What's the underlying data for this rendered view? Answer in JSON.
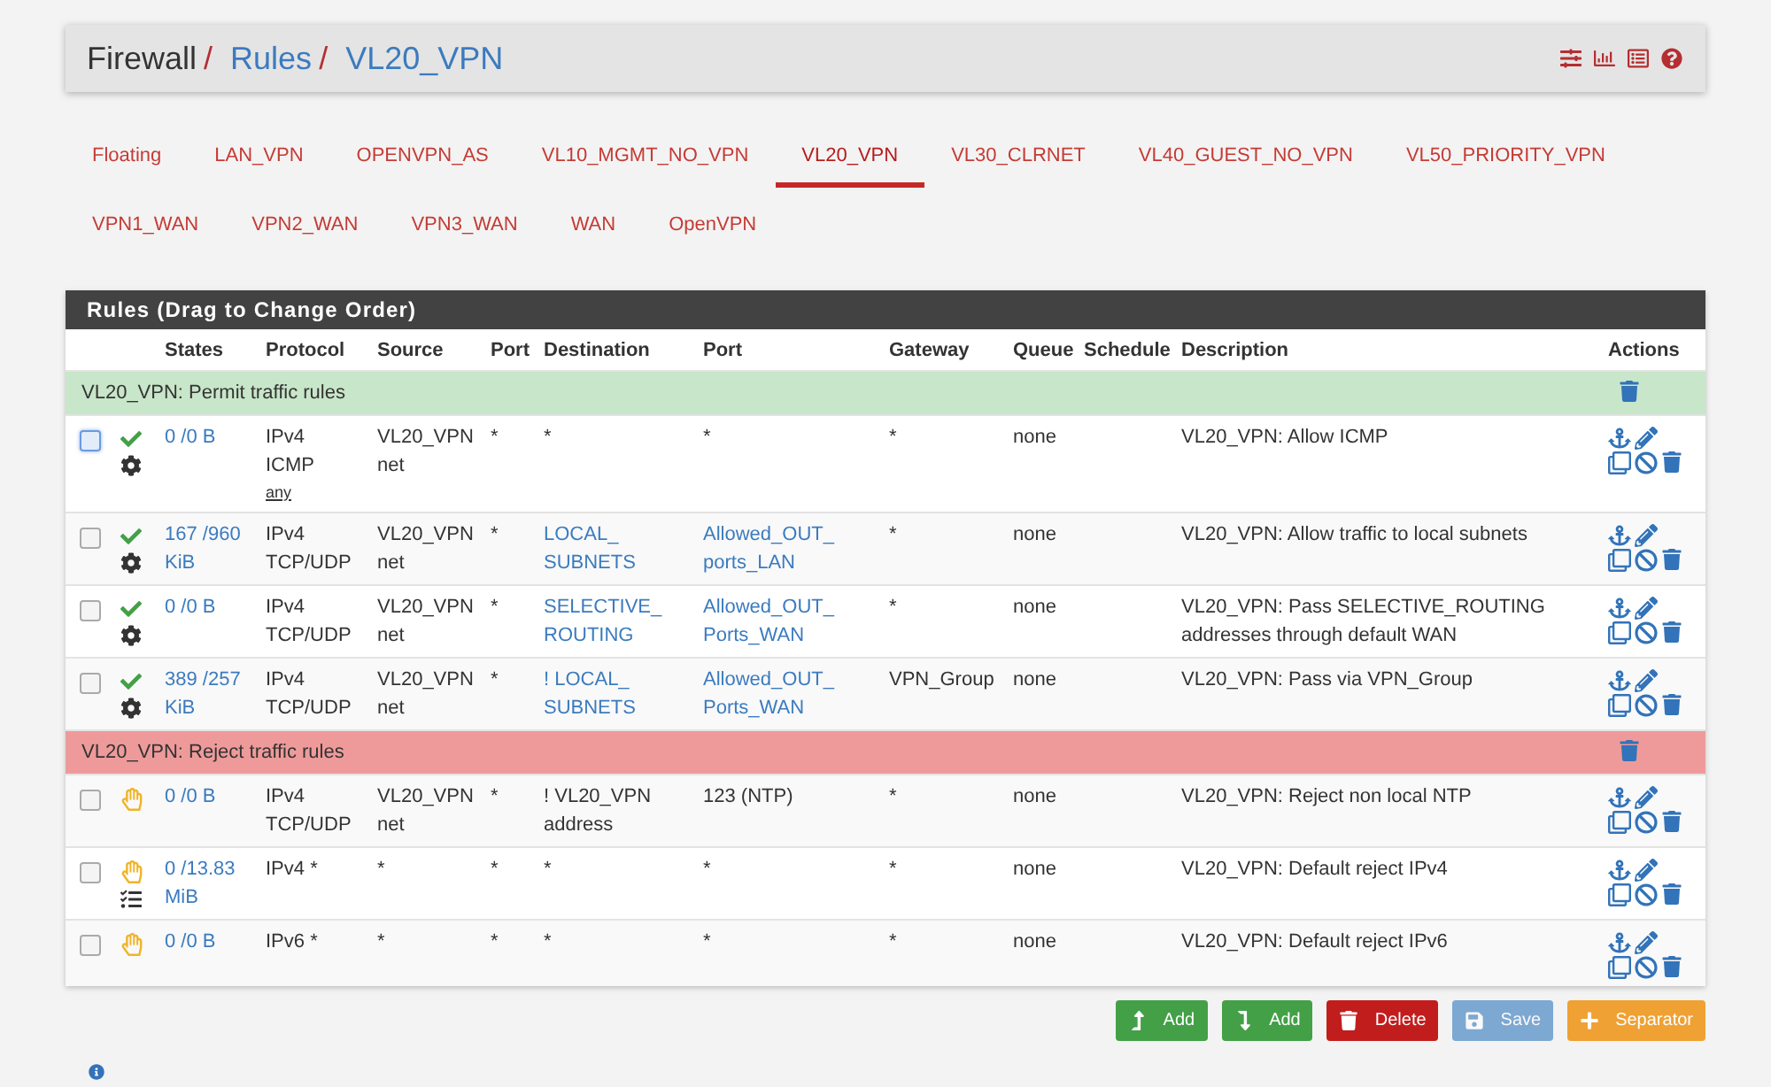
{
  "breadcrumb": [
    {
      "text": "Firewall",
      "link": false,
      "separator": "/"
    },
    {
      "text": "Rules",
      "link": true,
      "separator": "/"
    },
    {
      "text": "VL20_VPN",
      "link": true
    }
  ],
  "tab_rows": [
    [
      {
        "label": "Floating",
        "selected": false
      },
      {
        "label": "LAN_VPN",
        "selected": false
      },
      {
        "label": "OPENVPN_AS",
        "selected": false
      },
      {
        "label": "VL10_MGMT_NO_VPN",
        "selected": false
      },
      {
        "label": "VL20_VPN",
        "selected": true
      },
      {
        "label": "VL30_CLRNET",
        "selected": false
      },
      {
        "label": "VL40_GUEST_NO_VPN",
        "selected": false
      },
      {
        "label": "VL50_PRIORITY_VPN",
        "selected": false
      }
    ],
    [
      {
        "label": "VPN1_WAN",
        "selected": false
      },
      {
        "label": "VPN2_WAN",
        "selected": false
      },
      {
        "label": "VPN3_WAN",
        "selected": false
      },
      {
        "label": "WAN",
        "selected": false
      },
      {
        "label": "OpenVPN",
        "selected": false
      }
    ]
  ],
  "rules_panel": {
    "title": "Rules (Drag to Change Order)",
    "columns": [
      "States",
      "Protocol",
      "Source",
      "Port",
      "Destination",
      "Port",
      "Gateway",
      "Queue",
      "Schedule",
      "Description",
      "Actions"
    ],
    "rows": [
      {
        "kind": "separator",
        "label": "VL20_VPN: Permit traffic rules",
        "color": "#c8e6c9"
      },
      {
        "kind": "pass",
        "checked": false,
        "focused": true,
        "advanced": true,
        "logged": false,
        "states": "0 /0 B",
        "protocol": [
          "IPv4",
          "ICMP"
        ],
        "protocol_detail": "any",
        "source": "VL20_VPN net",
        "source_port": "*",
        "destination": {
          "text": "*",
          "link": false
        },
        "destination_port": {
          "text": "*",
          "link": false
        },
        "gateway": "*",
        "queue": "none",
        "description": "VL20_VPN: Allow ICMP"
      },
      {
        "kind": "pass",
        "checked": false,
        "focused": false,
        "advanced": true,
        "logged": false,
        "states": "167 /960 KiB",
        "protocol": [
          "IPv4",
          "TCP/UDP"
        ],
        "source": "VL20_VPN net",
        "source_port": "*",
        "destination": {
          "text": "LOCAL_SUBNETS",
          "link": true
        },
        "destination_port": {
          "text": "Allowed_OUT_ports_LAN",
          "link": true
        },
        "gateway": "*",
        "queue": "none",
        "description": "VL20_VPN: Allow traffic to local subnets"
      },
      {
        "kind": "pass",
        "checked": false,
        "focused": false,
        "advanced": true,
        "logged": false,
        "states": "0 /0 B",
        "protocol": [
          "IPv4",
          "TCP/UDP"
        ],
        "source": "VL20_VPN net",
        "source_port": "*",
        "destination": {
          "text": "SELECTIVE_ROUTING",
          "link": true
        },
        "destination_port": {
          "text": "Allowed_OUT_Ports_WAN",
          "link": true
        },
        "gateway": "*",
        "queue": "none",
        "description": "VL20_VPN: Pass SELECTIVE_ROUTING addresses through default WAN"
      },
      {
        "kind": "pass",
        "checked": false,
        "focused": false,
        "advanced": true,
        "logged": false,
        "states": "389 /257 KiB",
        "protocol": [
          "IPv4",
          "TCP/UDP"
        ],
        "source": "VL20_VPN net",
        "source_port": "*",
        "destination": {
          "text": "! LOCAL_SUBNETS",
          "link": true
        },
        "destination_port": {
          "text": "Allowed_OUT_Ports_WAN",
          "link": true
        },
        "gateway": "VPN_Group",
        "queue": "none",
        "description": "VL20_VPN: Pass via VPN_Group"
      },
      {
        "kind": "separator",
        "label": "VL20_VPN: Reject traffic rules",
        "color": "#ef9a9a"
      },
      {
        "kind": "reject",
        "checked": false,
        "focused": false,
        "advanced": false,
        "logged": false,
        "states": "0 /0 B",
        "protocol": [
          "IPv4",
          "TCP/UDP"
        ],
        "source": "VL20_VPN net",
        "source_port": "*",
        "destination": {
          "text": "! VL20_VPN address",
          "link": false
        },
        "destination_port": {
          "text": "123 (NTP)",
          "link": false
        },
        "gateway": "*",
        "queue": "none",
        "description": "VL20_VPN: Reject non local NTP"
      },
      {
        "kind": "reject",
        "checked": false,
        "focused": false,
        "advanced": false,
        "logged": true,
        "states": "0 /13.83 MiB",
        "protocol": [
          "IPv4 *"
        ],
        "source": "*",
        "source_port": "*",
        "destination": {
          "text": "*",
          "link": false
        },
        "destination_port": {
          "text": "*",
          "link": false
        },
        "gateway": "*",
        "queue": "none",
        "description": "VL20_VPN: Default reject IPv4"
      },
      {
        "kind": "reject",
        "checked": false,
        "focused": false,
        "advanced": false,
        "logged": false,
        "states": "0 /0 B",
        "protocol": [
          "IPv6 *"
        ],
        "source": "*",
        "source_port": "*",
        "destination": {
          "text": "*",
          "link": false
        },
        "destination_port": {
          "text": "*",
          "link": false
        },
        "gateway": "*",
        "queue": "none",
        "description": "VL20_VPN: Default reject IPv6"
      }
    ]
  },
  "buttons": [
    {
      "kind": "above",
      "label": "Add",
      "disabled": false
    },
    {
      "kind": "below",
      "label": "Add",
      "disabled": false
    },
    {
      "kind": "delete",
      "label": "Delete",
      "disabled": false
    },
    {
      "kind": "save",
      "label": "Save",
      "disabled": true
    },
    {
      "kind": "separator",
      "label": "Separator",
      "disabled": false
    }
  ]
}
